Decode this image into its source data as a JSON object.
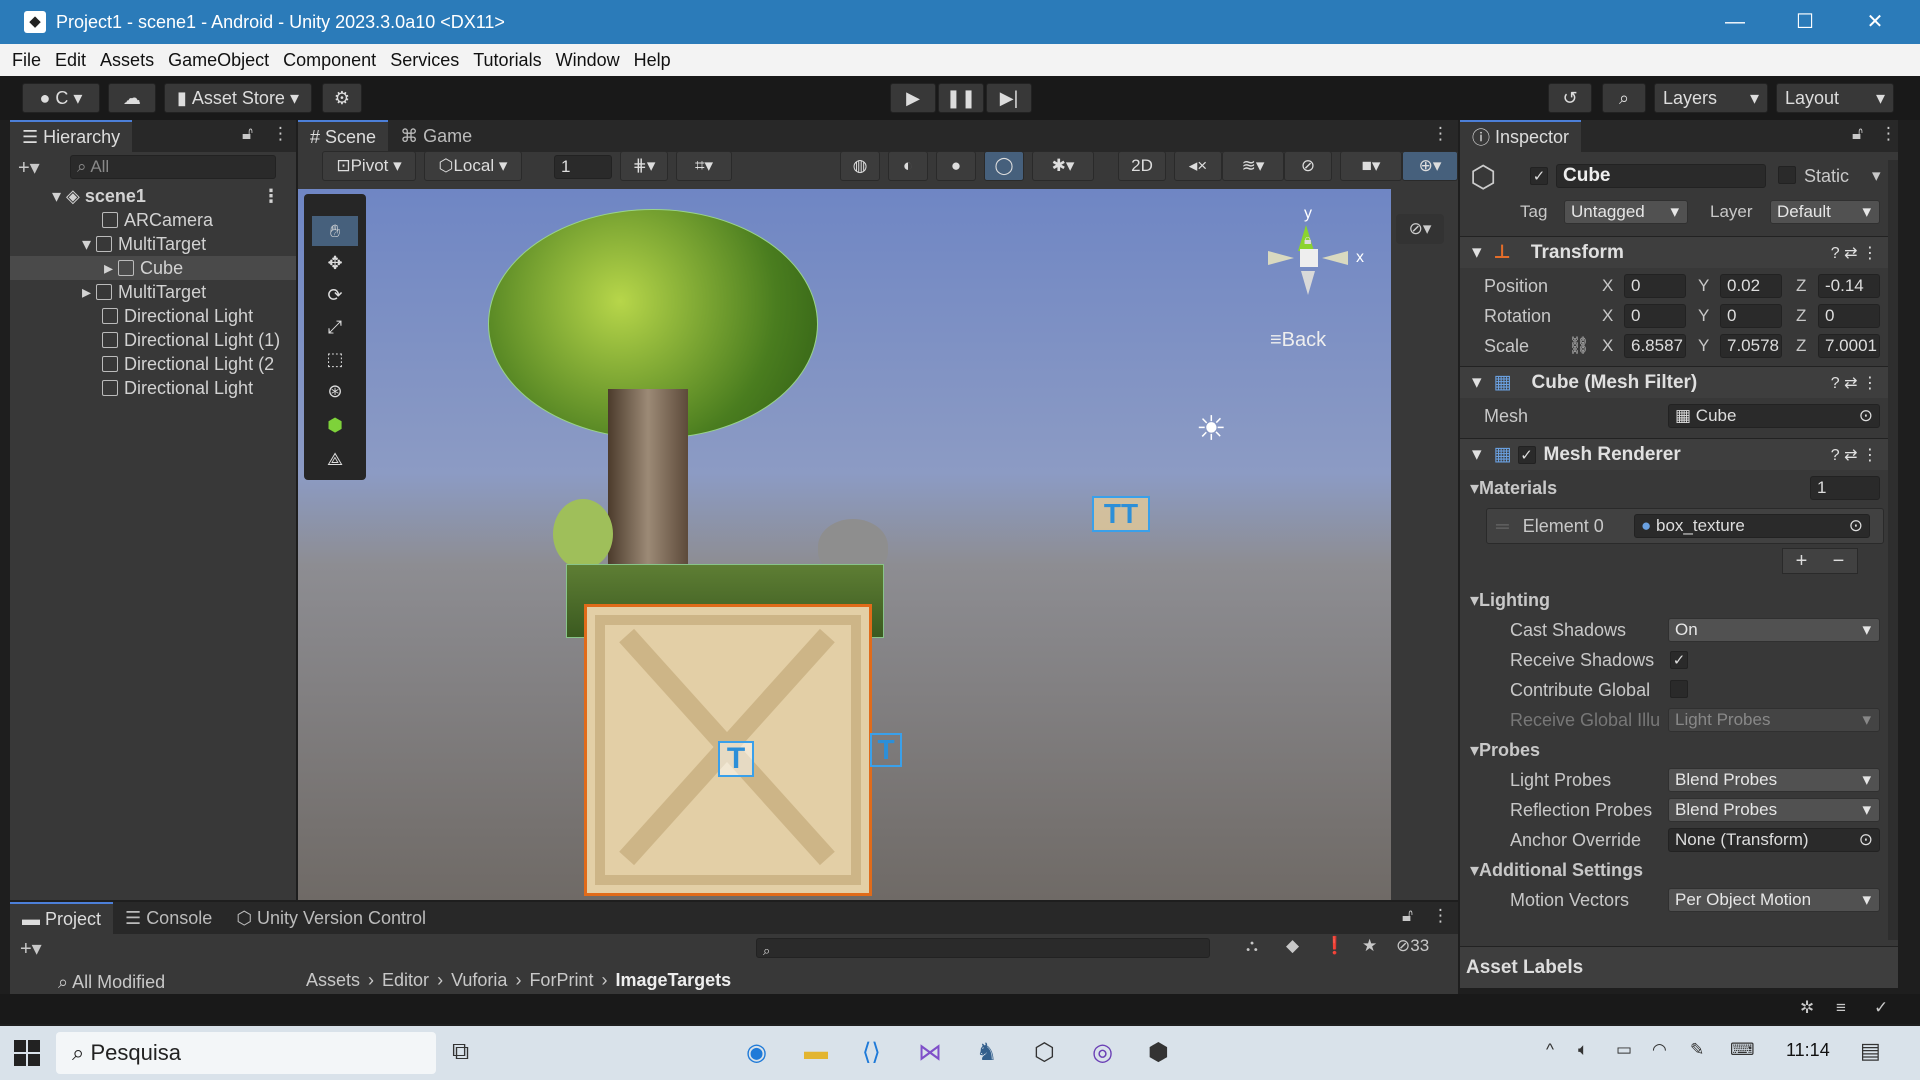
{
  "titlebar": {
    "title": "Project1 - scene1 - Android - Unity 2023.3.0a10 <DX11>",
    "min": "—",
    "max": "☐",
    "close": "✕"
  },
  "menu": [
    "File",
    "Edit",
    "Assets",
    "GameObject",
    "Component",
    "Services",
    "Tutorials",
    "Window",
    "Help"
  ],
  "toolbar": {
    "account": "C",
    "asset_store": "Asset Store",
    "layers": "Layers",
    "layout": "Layout"
  },
  "hierarchy": {
    "title": "Hierarchy",
    "search_placeholder": "All",
    "scene": "scene1",
    "items": [
      {
        "label": "ARCamera"
      },
      {
        "label": "MultiTarget"
      },
      {
        "label": "Cube"
      },
      {
        "label": "MultiTarget"
      },
      {
        "label": "Directional Light"
      },
      {
        "label": "Directional Light (1)"
      },
      {
        "label": "Directional Light (2"
      },
      {
        "label": "Directional Light"
      }
    ]
  },
  "scene": {
    "tab_scene": "Scene",
    "tab_game": "Game",
    "pivot": "Pivot",
    "local": "Local",
    "grid_value": "1",
    "btn_2d": "2D",
    "gizmo_back": "≡Back",
    "axis_y": "y",
    "axis_x": "x"
  },
  "inspector": {
    "title": "Inspector",
    "object_name": "Cube",
    "static": "Static",
    "tag_label": "Tag",
    "tag_value": "Untagged",
    "layer_label": "Layer",
    "layer_value": "Default",
    "transform": {
      "title": "Transform",
      "position_label": "Position",
      "rotation_label": "Rotation",
      "scale_label": "Scale",
      "position": {
        "x": "0",
        "y": "0.02",
        "z": "-0.14"
      },
      "rotation": {
        "x": "0",
        "y": "0",
        "z": "0"
      },
      "scale": {
        "x": "6.8587",
        "y": "7.0578",
        "z": "7.0001"
      }
    },
    "mesh_filter": {
      "title": "Cube (Mesh Filter)",
      "mesh_label": "Mesh",
      "mesh_value": "Cube"
    },
    "mesh_renderer": {
      "title": "Mesh Renderer",
      "materials_label": "Materials",
      "materials_count": "1",
      "element0_label": "Element 0",
      "element0_value": "box_texture",
      "lighting_label": "Lighting",
      "cast_shadows_label": "Cast Shadows",
      "cast_shadows_value": "On",
      "receive_shadows_label": "Receive Shadows",
      "contribute_global_label": "Contribute Global",
      "receive_global_label": "Receive Global Illu",
      "receive_global_value": "Light Probes",
      "probes_label": "Probes",
      "light_probes_label": "Light Probes",
      "light_probes_value": "Blend Probes",
      "reflection_probes_label": "Reflection Probes",
      "reflection_probes_value": "Blend Probes",
      "anchor_override_label": "Anchor Override",
      "anchor_override_value": "None (Transform)",
      "additional_label": "Additional Settings",
      "motion_vectors_label": "Motion Vectors",
      "motion_vectors_value": "Per Object Motion"
    },
    "asset_labels": "Asset Labels"
  },
  "bottom": {
    "tab_project": "Project",
    "tab_console": "Console",
    "tab_vc": "Unity Version Control",
    "all_modified": "All Modified",
    "breadcrumb": [
      "Assets",
      "Editor",
      "Vuforia",
      "ForPrint",
      "ImageTargets"
    ],
    "hidden_count": "33"
  },
  "taskbar": {
    "search_placeholder": "Pesquisa",
    "time": "11:14"
  }
}
